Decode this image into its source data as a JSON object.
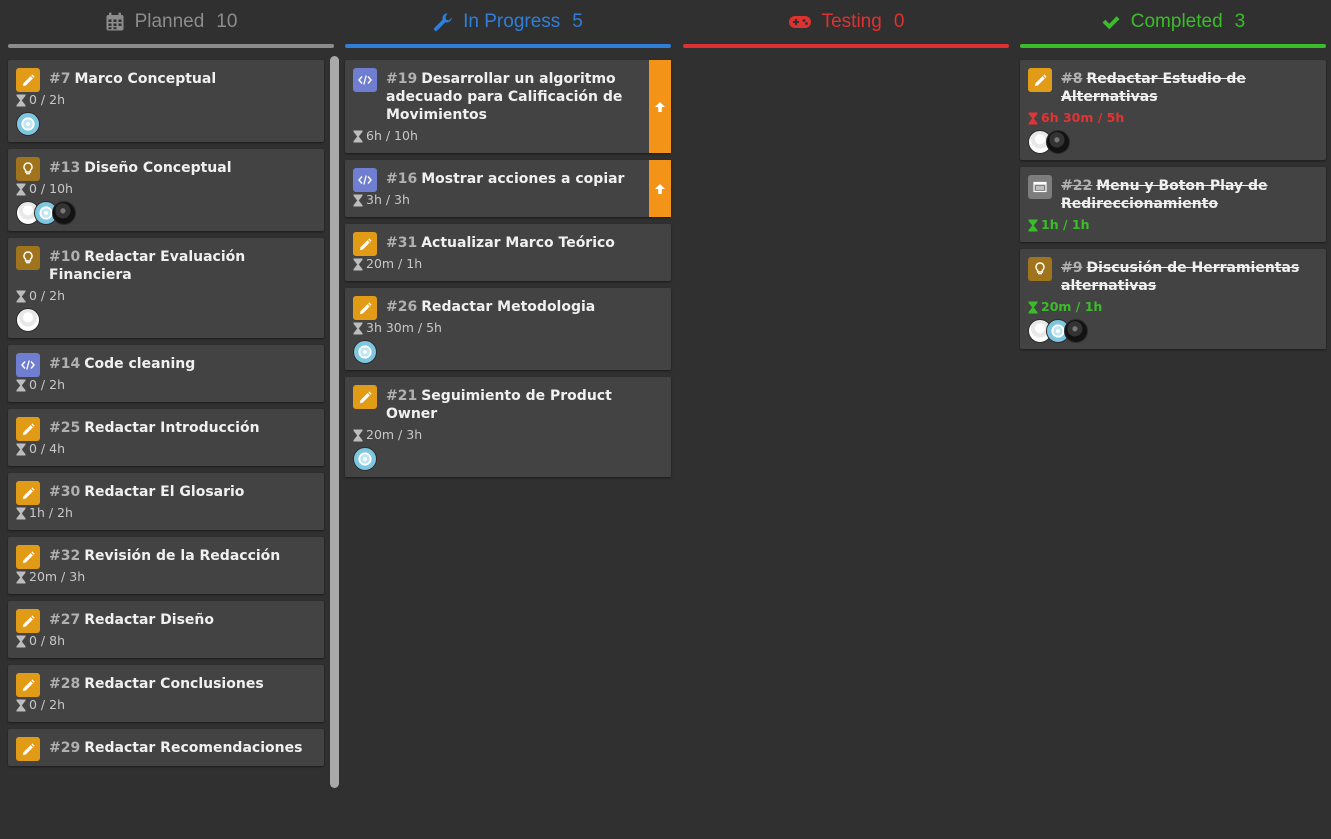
{
  "colors": {
    "planned": "#8c8c8c",
    "in_progress": "#2f7fd8",
    "testing": "#de3232",
    "completed": "#3bbd29",
    "priority": "#f39418",
    "type_task": "#e29b17",
    "type_idea": "#a0741c",
    "type_code": "#6f7ed0",
    "type_ui": "#7d7d7d"
  },
  "columns": [
    {
      "title": "Planned",
      "count": "10",
      "icon": "calendar-icon",
      "cards": [
        {
          "num": "#7",
          "title": "Marco Conceptual",
          "type": "task",
          "time": "0 / 2h",
          "avatars": [
            "flake"
          ]
        },
        {
          "num": "#13",
          "title": "Diseño Conceptual",
          "type": "idea",
          "time": "0 / 10h",
          "avatars": [
            "white",
            "flake",
            "dark"
          ]
        },
        {
          "num": "#10",
          "title": "Redactar Evaluación Financiera",
          "type": "idea",
          "time": "0 / 2h",
          "avatars": [
            "white"
          ]
        },
        {
          "num": "#14",
          "title": "Code cleaning",
          "type": "code",
          "time": "0 / 2h",
          "avatars": []
        },
        {
          "num": "#25",
          "title": "Redactar Introducción",
          "type": "task",
          "time": "0 / 4h",
          "avatars": []
        },
        {
          "num": "#30",
          "title": "Redactar El Glosario",
          "type": "task",
          "time": "1h / 2h",
          "avatars": []
        },
        {
          "num": "#32",
          "title": "Revisión de la Redacción",
          "type": "task",
          "time": "20m / 3h",
          "avatars": []
        },
        {
          "num": "#27",
          "title": "Redactar Diseño",
          "type": "task",
          "time": "0 / 8h",
          "avatars": []
        },
        {
          "num": "#28",
          "title": "Redactar Conclusiones",
          "type": "task",
          "time": "0 / 2h",
          "avatars": []
        },
        {
          "num": "#29",
          "title": "Redactar Recomendaciones",
          "type": "task",
          "time": "",
          "avatars": []
        }
      ]
    },
    {
      "title": "In Progress",
      "count": "5",
      "icon": "wrench-icon",
      "cards": [
        {
          "num": "#19",
          "title": "Desarrollar un algoritmo adecuado para Calificación de Movimientos",
          "type": "code",
          "time": "6h / 10h",
          "avatars": [],
          "priority": true
        },
        {
          "num": "#16",
          "title": "Mostrar acciones a copiar",
          "type": "code",
          "time": "3h / 3h",
          "avatars": [],
          "priority": true
        },
        {
          "num": "#31",
          "title": "Actualizar Marco Teórico",
          "type": "task",
          "time": "20m / 1h",
          "avatars": []
        },
        {
          "num": "#26",
          "title": "Redactar Metodologia",
          "type": "task",
          "time": "3h 30m / 5h",
          "avatars": [
            "flake"
          ]
        },
        {
          "num": "#21",
          "title": "Seguimiento de Product Owner",
          "type": "task",
          "time": "20m / 3h",
          "avatars": [
            "flake"
          ]
        }
      ]
    },
    {
      "title": "Testing",
      "count": "0",
      "icon": "gamepad-icon",
      "cards": []
    },
    {
      "title": "Completed",
      "count": "3",
      "icon": "check-icon",
      "cards": [
        {
          "num": "#8",
          "title": "Redactar Estudio de Alternativas",
          "type": "task",
          "time": "6h 30m / 5h",
          "status": "over",
          "avatars": [
            "white",
            "dark"
          ]
        },
        {
          "num": "#22",
          "title": "Menu y Boton Play de Redireccionamiento",
          "type": "ui",
          "time": "1h / 1h",
          "status": "ok",
          "avatars": []
        },
        {
          "num": "#9",
          "title": "Discusión de Herramientas alternativas",
          "type": "idea",
          "time": "20m / 1h",
          "status": "ok",
          "avatars": [
            "white",
            "flake",
            "dark"
          ]
        }
      ]
    }
  ]
}
